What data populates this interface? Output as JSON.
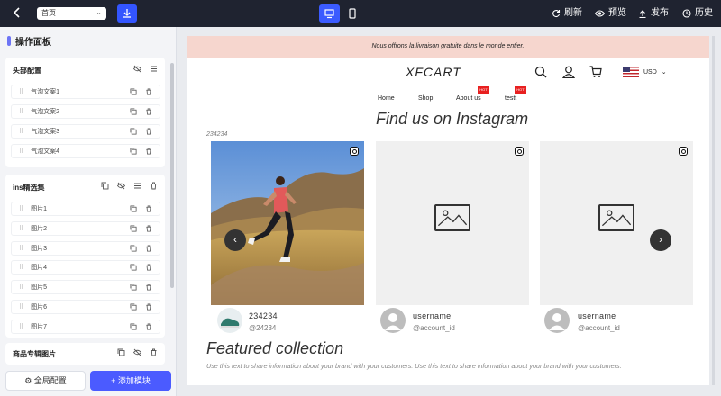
{
  "topbar": {
    "page_select": "首页",
    "refresh": "刷新",
    "preview": "预览",
    "publish": "发布",
    "history": "历史"
  },
  "sidebar": {
    "title": "操作面板",
    "header_group": {
      "title": "头部配置",
      "items": [
        "气泡文案1",
        "气泡文案2",
        "气泡文案3",
        "气泡文案4"
      ]
    },
    "ins_group": {
      "title": "ins精选集",
      "items": [
        "图片1",
        "图片2",
        "图片3",
        "图片4",
        "图片5",
        "图片6",
        "图片7"
      ]
    },
    "product_group": {
      "title": "商品专辑图片"
    },
    "global_button": "全局配置",
    "add_button": "添加模块"
  },
  "preview": {
    "announcement": "Nous offrons la livraison gratuite dans le monde entier.",
    "brand": "XFCART",
    "currency": "USD",
    "nav": [
      "Home",
      "Shop",
      "About us",
      "testt"
    ],
    "hot_badge": "HOT",
    "insta_title": "Find us on Instagram",
    "insta_subtitle": "234234",
    "cards": [
      {
        "name": "234234",
        "account": "@24234"
      },
      {
        "name": "username",
        "account": "@account_id"
      },
      {
        "name": "username",
        "account": "@account_id"
      }
    ],
    "featured_title": "Featured collection",
    "featured_desc": "Use this text to share information about your brand with your customers. Use this text to share information about your brand with your customers."
  },
  "colors": {
    "topbar_bg": "#1f2330",
    "accent": "#4b5bff",
    "announce_bg": "#f6d6ce",
    "hot": "#e82020"
  }
}
